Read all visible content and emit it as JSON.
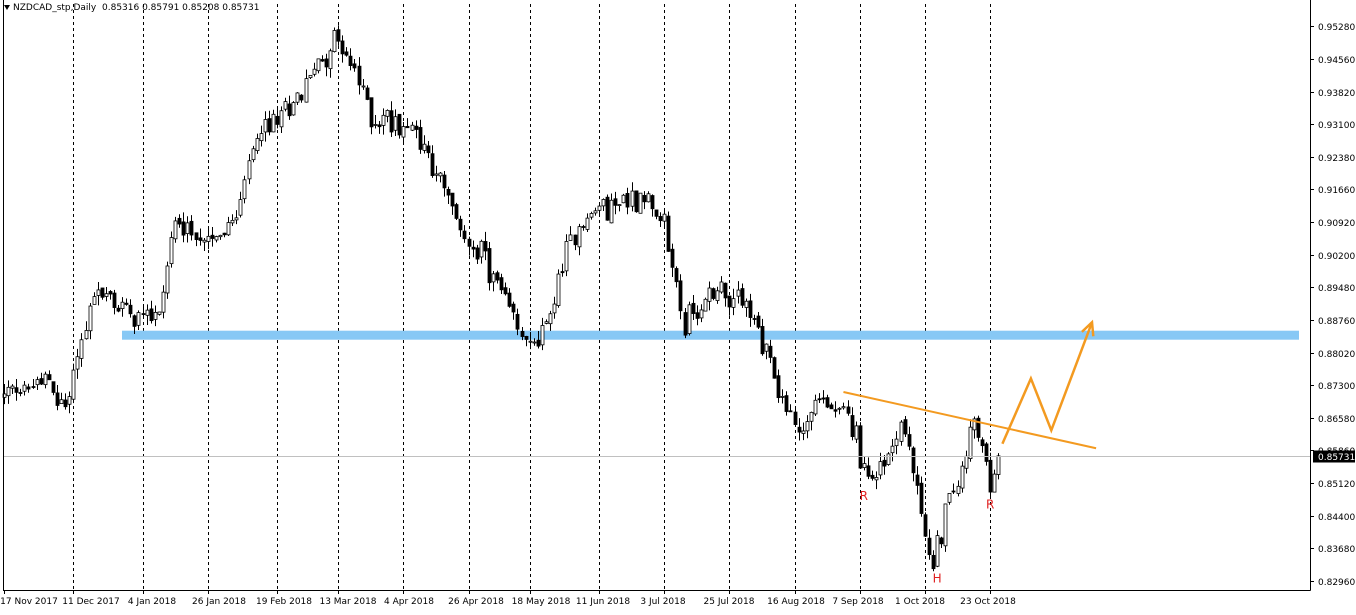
{
  "header": {
    "symbol_line": "NZDCAD_stp,Daily",
    "ohlc_line": "0.85316 0.85791 0.85208 0.85731"
  },
  "colors": {
    "bull": "#000000",
    "bear": "#000000",
    "resistance_zone": "#87c8f5",
    "trend": "#f39a20",
    "annotation": "#e02020",
    "price_label_bg": "#000000"
  },
  "current_price_label": "0.85731",
  "chart_data": {
    "type": "candlestick",
    "title": "NZDCAD_stp,Daily",
    "ylim": [
      0.8275,
      0.9555
    ],
    "y_ticks": [
      "0.95280",
      "0.94560",
      "0.93820",
      "0.93100",
      "0.92380",
      "0.91660",
      "0.90920",
      "0.90200",
      "0.89480",
      "0.88760",
      "0.88020",
      "0.87300",
      "0.86580",
      "0.85860",
      "0.85120",
      "0.84400",
      "0.83680",
      "0.82960"
    ],
    "x_tick_labels": [
      "17 Nov 2017",
      "11 Dec 2017",
      "4 Jan 2018",
      "26 Jan 2018",
      "19 Feb 2018",
      "13 Mar 2018",
      "4 Apr 2018",
      "26 Apr 2018",
      "18 May 2018",
      "11 Jun 2018",
      "3 Jul 2018",
      "25 Jul 2018",
      "16 Aug 2018",
      "7 Sep 2018",
      "1 Oct 2018",
      "23 Oct 2018"
    ],
    "grid_vertical": true,
    "current_price": 0.85731,
    "path_anchors": [
      {
        "i": 0,
        "p": 0.87
      },
      {
        "i": 10,
        "p": 0.874
      },
      {
        "i": 15,
        "p": 0.868
      },
      {
        "i": 22,
        "p": 0.894
      },
      {
        "i": 32,
        "p": 0.889
      },
      {
        "i": 38,
        "p": 0.889
      },
      {
        "i": 42,
        "p": 0.91
      },
      {
        "i": 48,
        "p": 0.905
      },
      {
        "i": 56,
        "p": 0.908
      },
      {
        "i": 62,
        "p": 0.928
      },
      {
        "i": 70,
        "p": 0.934
      },
      {
        "i": 78,
        "p": 0.946
      },
      {
        "i": 82,
        "p": 0.95
      },
      {
        "i": 86,
        "p": 0.942
      },
      {
        "i": 90,
        "p": 0.933
      },
      {
        "i": 100,
        "p": 0.931
      },
      {
        "i": 105,
        "p": 0.922
      },
      {
        "i": 112,
        "p": 0.907
      },
      {
        "i": 118,
        "p": 0.901
      },
      {
        "i": 125,
        "p": 0.887
      },
      {
        "i": 129,
        "p": 0.881
      },
      {
        "i": 133,
        "p": 0.886
      },
      {
        "i": 138,
        "p": 0.902
      },
      {
        "i": 142,
        "p": 0.91
      },
      {
        "i": 150,
        "p": 0.914
      },
      {
        "i": 157,
        "p": 0.915
      },
      {
        "i": 162,
        "p": 0.908
      },
      {
        "i": 167,
        "p": 0.887
      },
      {
        "i": 170,
        "p": 0.889
      },
      {
        "i": 175,
        "p": 0.895
      },
      {
        "i": 182,
        "p": 0.891
      },
      {
        "i": 187,
        "p": 0.88
      },
      {
        "i": 191,
        "p": 0.87
      },
      {
        "i": 195,
        "p": 0.862
      },
      {
        "i": 200,
        "p": 0.87
      },
      {
        "i": 205,
        "p": 0.867
      },
      {
        "i": 208,
        "p": 0.864
      },
      {
        "i": 212,
        "p": 0.852
      },
      {
        "i": 216,
        "p": 0.856
      },
      {
        "i": 220,
        "p": 0.865
      },
      {
        "i": 223,
        "p": 0.854
      },
      {
        "i": 226,
        "p": 0.839
      },
      {
        "i": 228,
        "p": 0.833
      },
      {
        "i": 231,
        "p": 0.845
      },
      {
        "i": 234,
        "p": 0.851
      },
      {
        "i": 238,
        "p": 0.865
      },
      {
        "i": 242,
        "p": 0.85
      },
      {
        "i": 244,
        "p": 0.857
      }
    ],
    "resistance_zone": {
      "from_index": 30,
      "to_index": 325,
      "low": 0.8833,
      "high": 0.8849
    },
    "trendline": {
      "from": {
        "i": 206,
        "p": 0.8715
      },
      "to": {
        "i": 268,
        "p": 0.859
      }
    },
    "projection_path": [
      {
        "i": 245,
        "p": 0.86
      },
      {
        "i": 252,
        "p": 0.8745
      },
      {
        "i": 257,
        "p": 0.863
      },
      {
        "i": 267,
        "p": 0.887
      }
    ],
    "annotations": [
      {
        "text": "R",
        "i": 211,
        "p": 0.8475
      },
      {
        "text": "H",
        "i": 229,
        "p": 0.8292
      },
      {
        "text": "R",
        "i": 242,
        "p": 0.8456
      }
    ]
  }
}
